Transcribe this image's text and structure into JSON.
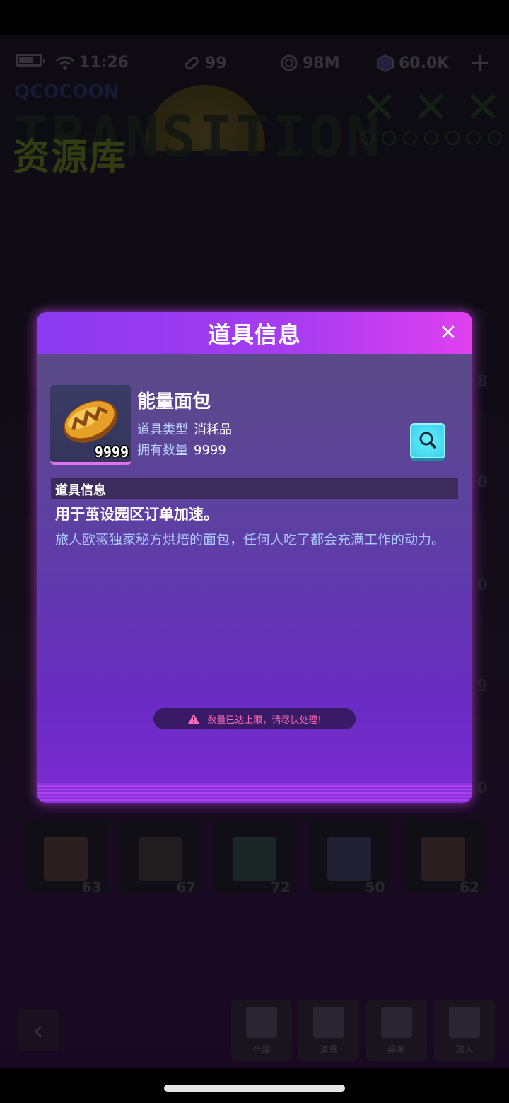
{
  "status_bar": {
    "time": "11:26",
    "stamina": "99",
    "coins": "98M",
    "gems": "60.0K"
  },
  "banner": {
    "title_cn": "资源库",
    "title_en": "TRANSITION",
    "small": "QCOCOON"
  },
  "background_counts": [
    "8",
    "0",
    "0",
    "9",
    "0"
  ],
  "characters": [
    {
      "level": "63"
    },
    {
      "level": "67"
    },
    {
      "level": "72"
    },
    {
      "level": "50"
    },
    {
      "level": "62"
    }
  ],
  "bottom_nav": {
    "tabs": [
      "全部",
      "道具",
      "装备",
      "旅人"
    ]
  },
  "modal": {
    "title": "道具信息",
    "item": {
      "name": "能量面包",
      "quantity_badge": "9999",
      "type_label": "道具类型",
      "type_value": "消耗品",
      "owned_label": "拥有数量",
      "owned_value": "9999"
    },
    "section_title": "道具信息",
    "usage": "用于茧设园区订单加速。",
    "flavor": "旅人欧薇独家秘方烘焙的面包，任何人吃了都会充满工作的动力。",
    "warning": "数量已达上限，请尽快处理!"
  },
  "colors": {
    "modal_header": "#a83cf0",
    "modal_body": "#5d3fa4",
    "accent_cyan": "#3ad0ec",
    "warning_text": "#ff6ab8"
  },
  "icons": [
    "battery-icon",
    "wifi-icon",
    "stamina-icon",
    "coin-icon",
    "gem-icon",
    "plus-icon",
    "close-icon",
    "bread-icon",
    "search-icon",
    "warning-icon",
    "back-arrow-icon"
  ]
}
